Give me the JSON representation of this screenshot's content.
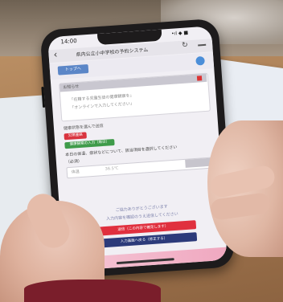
{
  "status_bar": {
    "time": "14:00",
    "signal": "•ıl ◆ ■"
  },
  "browser": {
    "title": "県内公立小中学校の予約システム",
    "nav_back": "‹",
    "nav_refresh": "↻"
  },
  "header": {
    "button_label": "トップへ"
  },
  "notice": {
    "title": "お知らせ",
    "body_1": "「在籍する児童生徒の健康観察を」",
    "body_2": "「オンラインで入力してください」"
  },
  "form": {
    "subtitle": "健康状態を選んで送信",
    "badge_red": "欠席連絡",
    "badge_green": "健康観察の入力（毎日）",
    "question": "本日の体温、症状などについて、該当項目を選択してください",
    "sub_label": "（必須）",
    "temp_label": "体温",
    "temp_value": "36.5℃"
  },
  "footer": {
    "note_1": "ご協力ありがとうございます",
    "note_2": "入力内容を確認のうえ送信してください",
    "button_submit": "送信（この内容で確定します）",
    "button_back": "入力画面へ戻る（修正する）"
  },
  "colors": {
    "phone_frame": "#1d1b1c",
    "screen_bg": "#f1eff4",
    "submit_red": "#e0303e",
    "back_navy": "#2c3a7a",
    "badge_green": "#3f9b4a",
    "bottom_pink": "#f0a8c0"
  }
}
